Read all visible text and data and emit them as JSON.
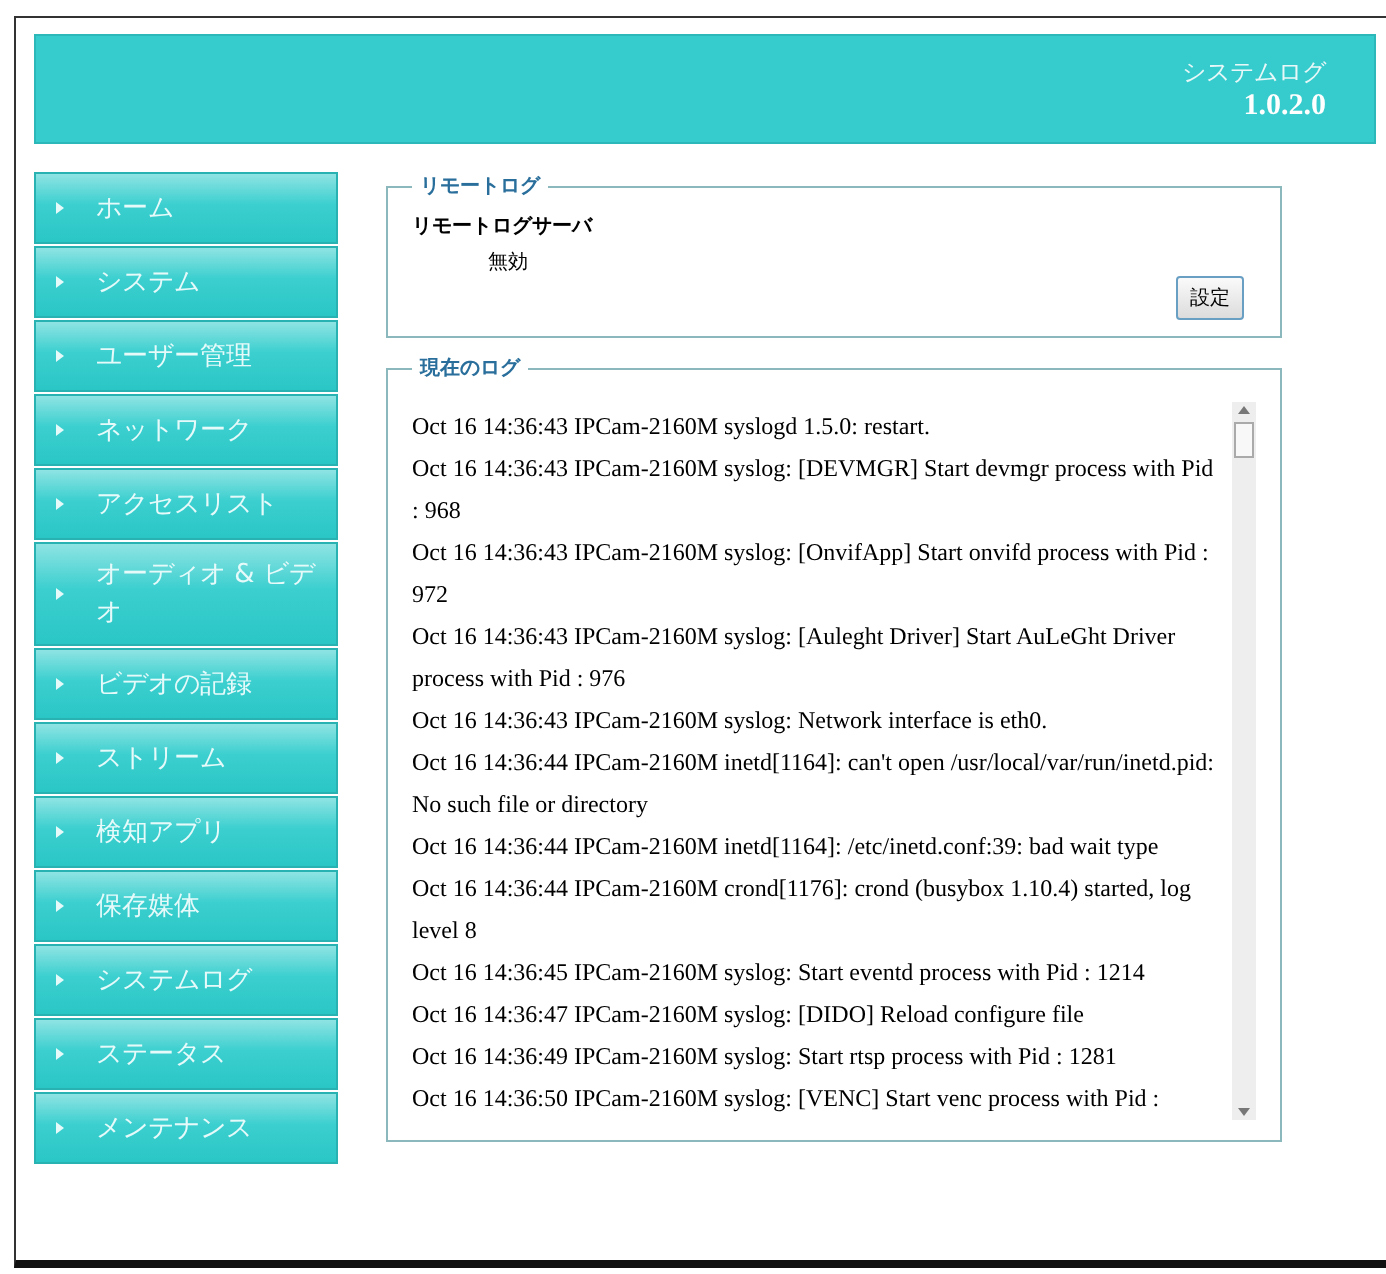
{
  "header": {
    "title": "システムログ",
    "version": "1.0.2.0"
  },
  "sidebar": {
    "items": [
      {
        "label": "ホーム"
      },
      {
        "label": "システム"
      },
      {
        "label": "ユーザー管理"
      },
      {
        "label": "ネットワーク"
      },
      {
        "label": "アクセスリスト"
      },
      {
        "label": "オーディオ & ビデオ"
      },
      {
        "label": "ビデオの記録"
      },
      {
        "label": "ストリーム"
      },
      {
        "label": "検知アプリ"
      },
      {
        "label": "保存媒体"
      },
      {
        "label": "システムログ"
      },
      {
        "label": "ステータス"
      },
      {
        "label": "メンテナンス"
      }
    ]
  },
  "remote_log": {
    "legend": "リモートログ",
    "label": "リモートログサーバ",
    "value": "無効",
    "button": "設定"
  },
  "current_log": {
    "legend": "現在のログ",
    "entries": [
      "Oct 16 14:36:43 IPCam-2160M syslogd 1.5.0: restart.",
      "Oct 16 14:36:43 IPCam-2160M syslog: [DEVMGR] Start devmgr process with Pid : 968",
      "Oct 16 14:36:43 IPCam-2160M syslog: [OnvifApp] Start onvifd process with Pid : 972",
      "Oct 16 14:36:43 IPCam-2160M syslog: [Auleght Driver] Start AuLeGht Driver process with Pid : 976",
      "Oct 16 14:36:43 IPCam-2160M syslog: Network interface is eth0.",
      "Oct 16 14:36:44 IPCam-2160M inetd[1164]: can't open /usr/local/var/run/inetd.pid: No such file or directory",
      "Oct 16 14:36:44 IPCam-2160M inetd[1164]: /etc/inetd.conf:39: bad wait type",
      "Oct 16 14:36:44 IPCam-2160M crond[1176]: crond (busybox 1.10.4) started, log level 8",
      "Oct 16 14:36:45 IPCam-2160M syslog: Start eventd process with Pid : 1214",
      "Oct 16 14:36:47 IPCam-2160M syslog: [DIDO] Reload configure file",
      "Oct 16 14:36:49 IPCam-2160M syslog: Start rtsp process with Pid : 1281",
      "Oct 16 14:36:50 IPCam-2160M syslog: [VENC] Start venc process with Pid :"
    ]
  }
}
